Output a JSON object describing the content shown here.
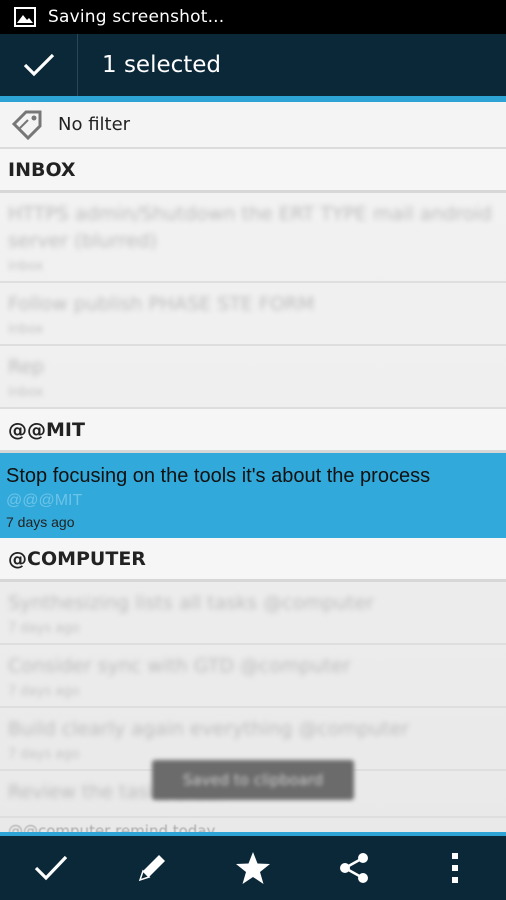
{
  "status_bar": {
    "text": "Saving screenshot..."
  },
  "action_bar": {
    "title": "1 selected"
  },
  "filter": {
    "label": "No filter"
  },
  "sections": [
    {
      "name": "INBOX",
      "tasks": [
        {
          "title": "HTTPS admin/Shutdown the ERT TYPE mail android server (blurred)",
          "sub": "inbox"
        },
        {
          "title": "Follow publish PHASE STE FORM",
          "sub": "inbox"
        },
        {
          "title": "Rep",
          "sub": "inbox"
        }
      ]
    },
    {
      "name": "@@MIT",
      "tasks": [
        {
          "title": "Stop focusing on the tools it's about the process",
          "context": "@@@MIT",
          "time": "7 days ago"
        }
      ]
    },
    {
      "name": "@COMPUTER",
      "tasks": [
        {
          "title": "Synthesizing lists all tasks @computer",
          "sub": "7 days ago"
        },
        {
          "title": "Consider sync with GTD @computer",
          "sub": "7 days ago"
        },
        {
          "title": "Build clearly again everything @computer",
          "sub": "7 days ago"
        },
        {
          "title": "Review the tasks order",
          "sub": ""
        }
      ]
    }
  ],
  "toast": {
    "text": "Saved to clipboard"
  },
  "bottom_partial": "@@computer remind today",
  "colors": {
    "accent": "#2ea4d6",
    "bar": "#0b2838",
    "selected": "#31a9da"
  }
}
